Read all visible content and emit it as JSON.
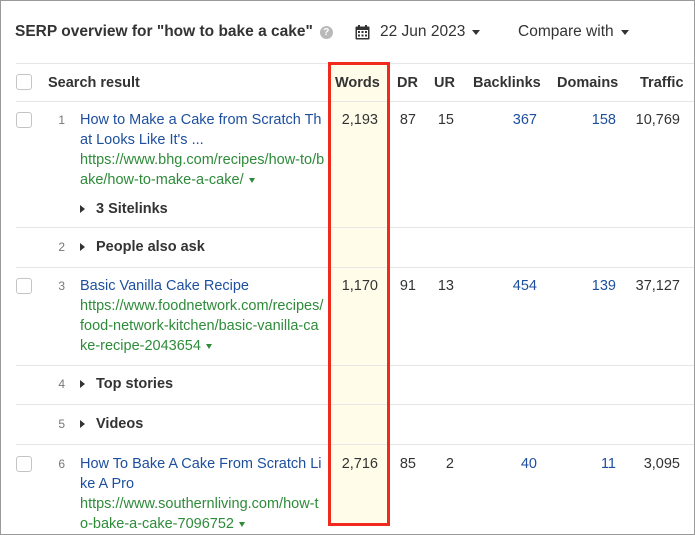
{
  "header": {
    "title": "SERP overview for \"how to bake a cake\"",
    "help_icon": "question-circle-icon",
    "date": "22 Jun 2023",
    "calendar_icon": "calendar-icon",
    "compare_label": "Compare with"
  },
  "table": {
    "columns": [
      "Search result",
      "Words",
      "DR",
      "UR",
      "Backlinks",
      "Domains",
      "Traffic"
    ],
    "highlighted_column": "Words",
    "highlight_color": "#f02a1d",
    "rows": [
      {
        "type": "organic",
        "position": "1",
        "title": "How to Make a Cake from Scratch That Looks Like It's ...",
        "url": "https://www.bhg.com/recipes/how-to/bake/how-to-make-a-cake/",
        "words": "2,193",
        "dr": "87",
        "ur": "15",
        "backlinks": "367",
        "domains": "158",
        "traffic": "10,769",
        "sitelinks": "3 Sitelinks"
      },
      {
        "type": "feature",
        "position": "2",
        "label": "People also ask"
      },
      {
        "type": "organic",
        "position": "3",
        "title": "Basic Vanilla Cake Recipe",
        "url": "https://www.foodnetwork.com/recipes/food-network-kitchen/basic-vanilla-cake-recipe-2043654",
        "words": "1,170",
        "dr": "91",
        "ur": "13",
        "backlinks": "454",
        "domains": "139",
        "traffic": "37,127"
      },
      {
        "type": "feature",
        "position": "4",
        "label": "Top stories"
      },
      {
        "type": "feature",
        "position": "5",
        "label": "Videos"
      },
      {
        "type": "organic",
        "position": "6",
        "title": "How To Bake A Cake From Scratch Like A Pro",
        "url": "https://www.southernliving.com/how-to-bake-a-cake-7096752",
        "words": "2,716",
        "dr": "85",
        "ur": "2",
        "backlinks": "40",
        "domains": "11",
        "traffic": "3,095"
      }
    ]
  }
}
